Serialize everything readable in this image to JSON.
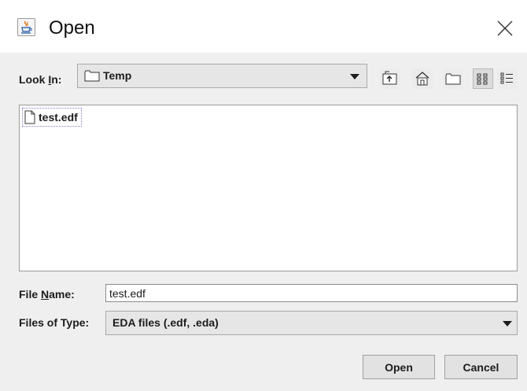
{
  "window": {
    "title": "Open"
  },
  "look_in": {
    "label_prefix": "Look ",
    "label_mnemonic": "I",
    "label_suffix": "n:",
    "value": "Temp"
  },
  "toolbar": {
    "up_icon": "up-one-level-icon",
    "home_icon": "home-icon",
    "new_folder_icon": "new-folder-icon",
    "list_view_icon": "list-view-icon",
    "details_view_icon": "details-view-icon"
  },
  "files": [
    {
      "name": "test.edf"
    }
  ],
  "file_name": {
    "label_prefix": "File ",
    "label_mnemonic": "N",
    "label_suffix": "ame:",
    "value": "test.edf"
  },
  "file_type": {
    "label": "Files of Type:",
    "value": "EDA files (.edf, .eda)"
  },
  "buttons": {
    "open": "Open",
    "cancel": "Cancel"
  }
}
